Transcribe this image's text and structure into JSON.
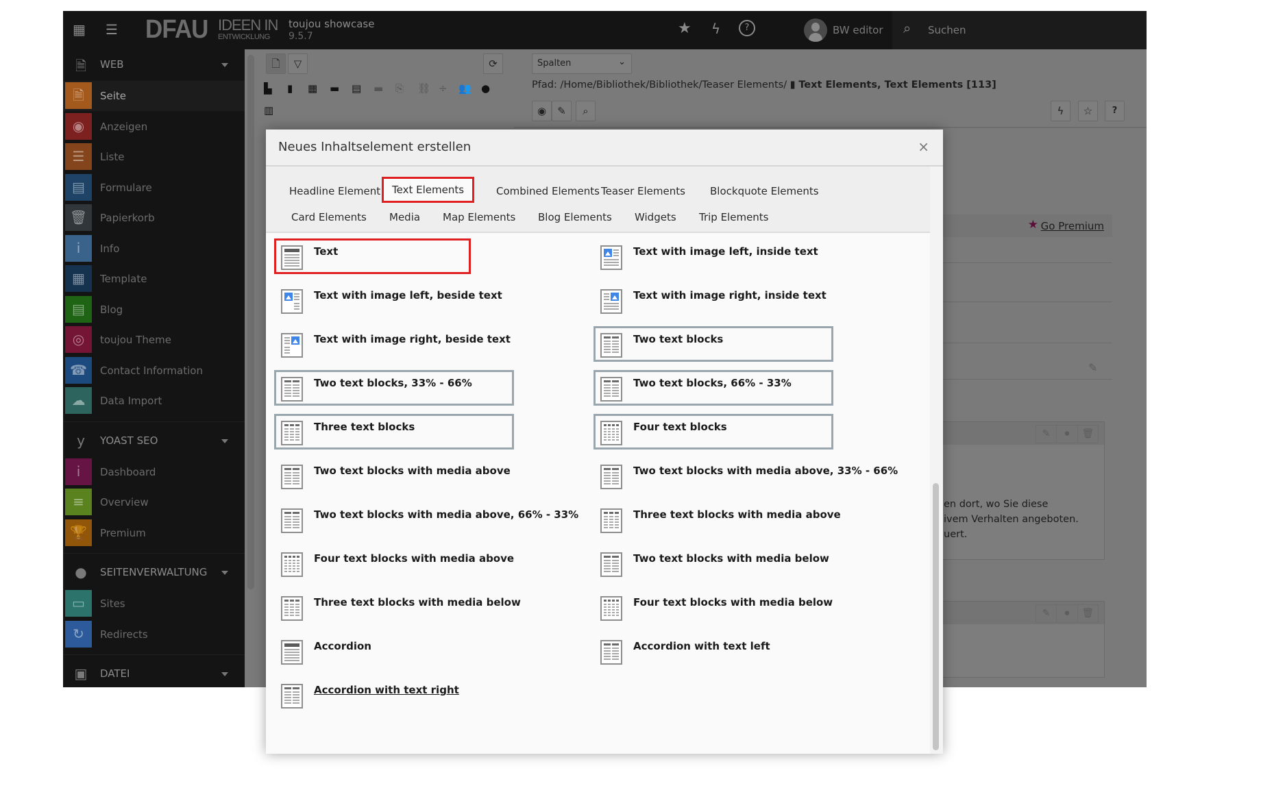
{
  "topbar": {
    "site_name": "toujou showcase",
    "version": "9.5.7",
    "logo_main": "DFAU",
    "logo_line1": "IDEEN IN",
    "logo_line2": "ENTWICKLUNG",
    "user": "BW editor",
    "search_label": "Suchen",
    "icons": [
      "grid-icon",
      "list-icon",
      "star-icon",
      "bolt-icon",
      "help-icon",
      "avatar",
      "search-icon"
    ]
  },
  "sidebar": {
    "groups": [
      {
        "label": "WEB",
        "icon": "page-icon",
        "items": [
          {
            "label": "Seite",
            "icon": "page-icon",
            "color": "#a45a1c",
            "active": true
          },
          {
            "label": "Anzeigen",
            "icon": "eye-icon",
            "color": "#7d2020"
          },
          {
            "label": "Liste",
            "icon": "list-icon",
            "color": "#84441c"
          },
          {
            "label": "Formulare",
            "icon": "form-icon",
            "color": "#1e4366"
          },
          {
            "label": "Papierkorb",
            "icon": "trash-icon",
            "color": "#30363a"
          },
          {
            "label": "Info",
            "icon": "info-icon",
            "color": "#3a638c"
          },
          {
            "label": "Template",
            "icon": "template-icon",
            "color": "#15324f"
          },
          {
            "label": "Blog",
            "icon": "blog-icon",
            "color": "#1f6314"
          },
          {
            "label": "toujou Theme",
            "icon": "fingerprint-icon",
            "color": "#751535"
          },
          {
            "label": "Contact Information",
            "icon": "contact-icon",
            "color": "#1d4a7e"
          },
          {
            "label": "Data Import",
            "icon": "cloud-download-icon",
            "color": "#2d645e"
          }
        ]
      },
      {
        "label": "YOAST SEO",
        "icon": "yoast-icon",
        "items": [
          {
            "label": "Dashboard",
            "icon": "info-icon",
            "color": "#661444"
          },
          {
            "label": "Overview",
            "icon": "menu-icon",
            "color": "#5a8320"
          },
          {
            "label": "Premium",
            "icon": "trophy-icon",
            "color": "#92560a"
          }
        ]
      },
      {
        "label": "SEITENVERWALTUNG",
        "icon": "globe-icon",
        "items": [
          {
            "label": "Sites",
            "icon": "sites-icon",
            "color": "#2c736b"
          },
          {
            "label": "Redirects",
            "icon": "redirect-icon",
            "color": "#2c5a9b"
          }
        ]
      },
      {
        "label": "DATEI",
        "icon": "image-icon",
        "items": []
      }
    ]
  },
  "docheader": {
    "view_select": "Spalten",
    "path_prefix": "Pfad: /Home/Bibliothek/Bibliothek/Teaser Elements/",
    "path_page": "Text Elements, Text Elements [113]"
  },
  "content": {
    "premium_link": "Go Premium",
    "text_lines": [
      "en dort, wo Sie diese",
      "ivem Verhalten angeboten.",
      "uert."
    ]
  },
  "modal": {
    "title": "Neues Inhaltselement erstellen",
    "close": "×",
    "tabs_row1": [
      "Headline Element",
      "Text Elements",
      "Combined Elements",
      "Teaser Elements",
      "Blockquote Elements"
    ],
    "tabs_row2": [
      "Card Elements",
      "Media",
      "Map Elements",
      "Blog Elements",
      "Widgets",
      "Trip Elements"
    ],
    "active_tab": "Text Elements",
    "items": [
      {
        "label": "Text",
        "icon": "text",
        "state": "marked"
      },
      {
        "label": "Text with image left, inside text",
        "icon": "img-left-inside"
      },
      {
        "label": "Text with image left, beside text",
        "icon": "img-left-beside"
      },
      {
        "label": "Text with image right, inside text",
        "icon": "img-right-inside"
      },
      {
        "label": "Text with image right, beside text",
        "icon": "img-right-beside"
      },
      {
        "label": "Two text blocks",
        "icon": "cols2",
        "state": "boxed"
      },
      {
        "label": "Two text blocks, 33% - 66%",
        "icon": "cols2",
        "state": "boxed"
      },
      {
        "label": "Two text blocks, 66% - 33%",
        "icon": "cols2",
        "state": "boxed"
      },
      {
        "label": "Three text blocks",
        "icon": "cols3",
        "state": "boxed"
      },
      {
        "label": "Four text blocks",
        "icon": "cols4",
        "state": "boxed"
      },
      {
        "label": "Two text blocks with media above",
        "icon": "cols2"
      },
      {
        "label": "Two text blocks with media above, 33% - 66%",
        "icon": "cols2"
      },
      {
        "label": "Two text blocks with media above, 66% - 33%",
        "icon": "cols2"
      },
      {
        "label": "Three text blocks with media above",
        "icon": "cols3"
      },
      {
        "label": "Four text blocks with media above",
        "icon": "cols4"
      },
      {
        "label": "Two text blocks with media below",
        "icon": "cols2"
      },
      {
        "label": "Three text blocks with media below",
        "icon": "cols3"
      },
      {
        "label": "Four text blocks with media below",
        "icon": "cols4"
      },
      {
        "label": "Accordion",
        "icon": "text"
      },
      {
        "label": "Accordion with text left",
        "icon": "cols2"
      },
      {
        "label": "Accordion with text right ",
        "icon": "cols2",
        "state": "underline"
      }
    ]
  }
}
